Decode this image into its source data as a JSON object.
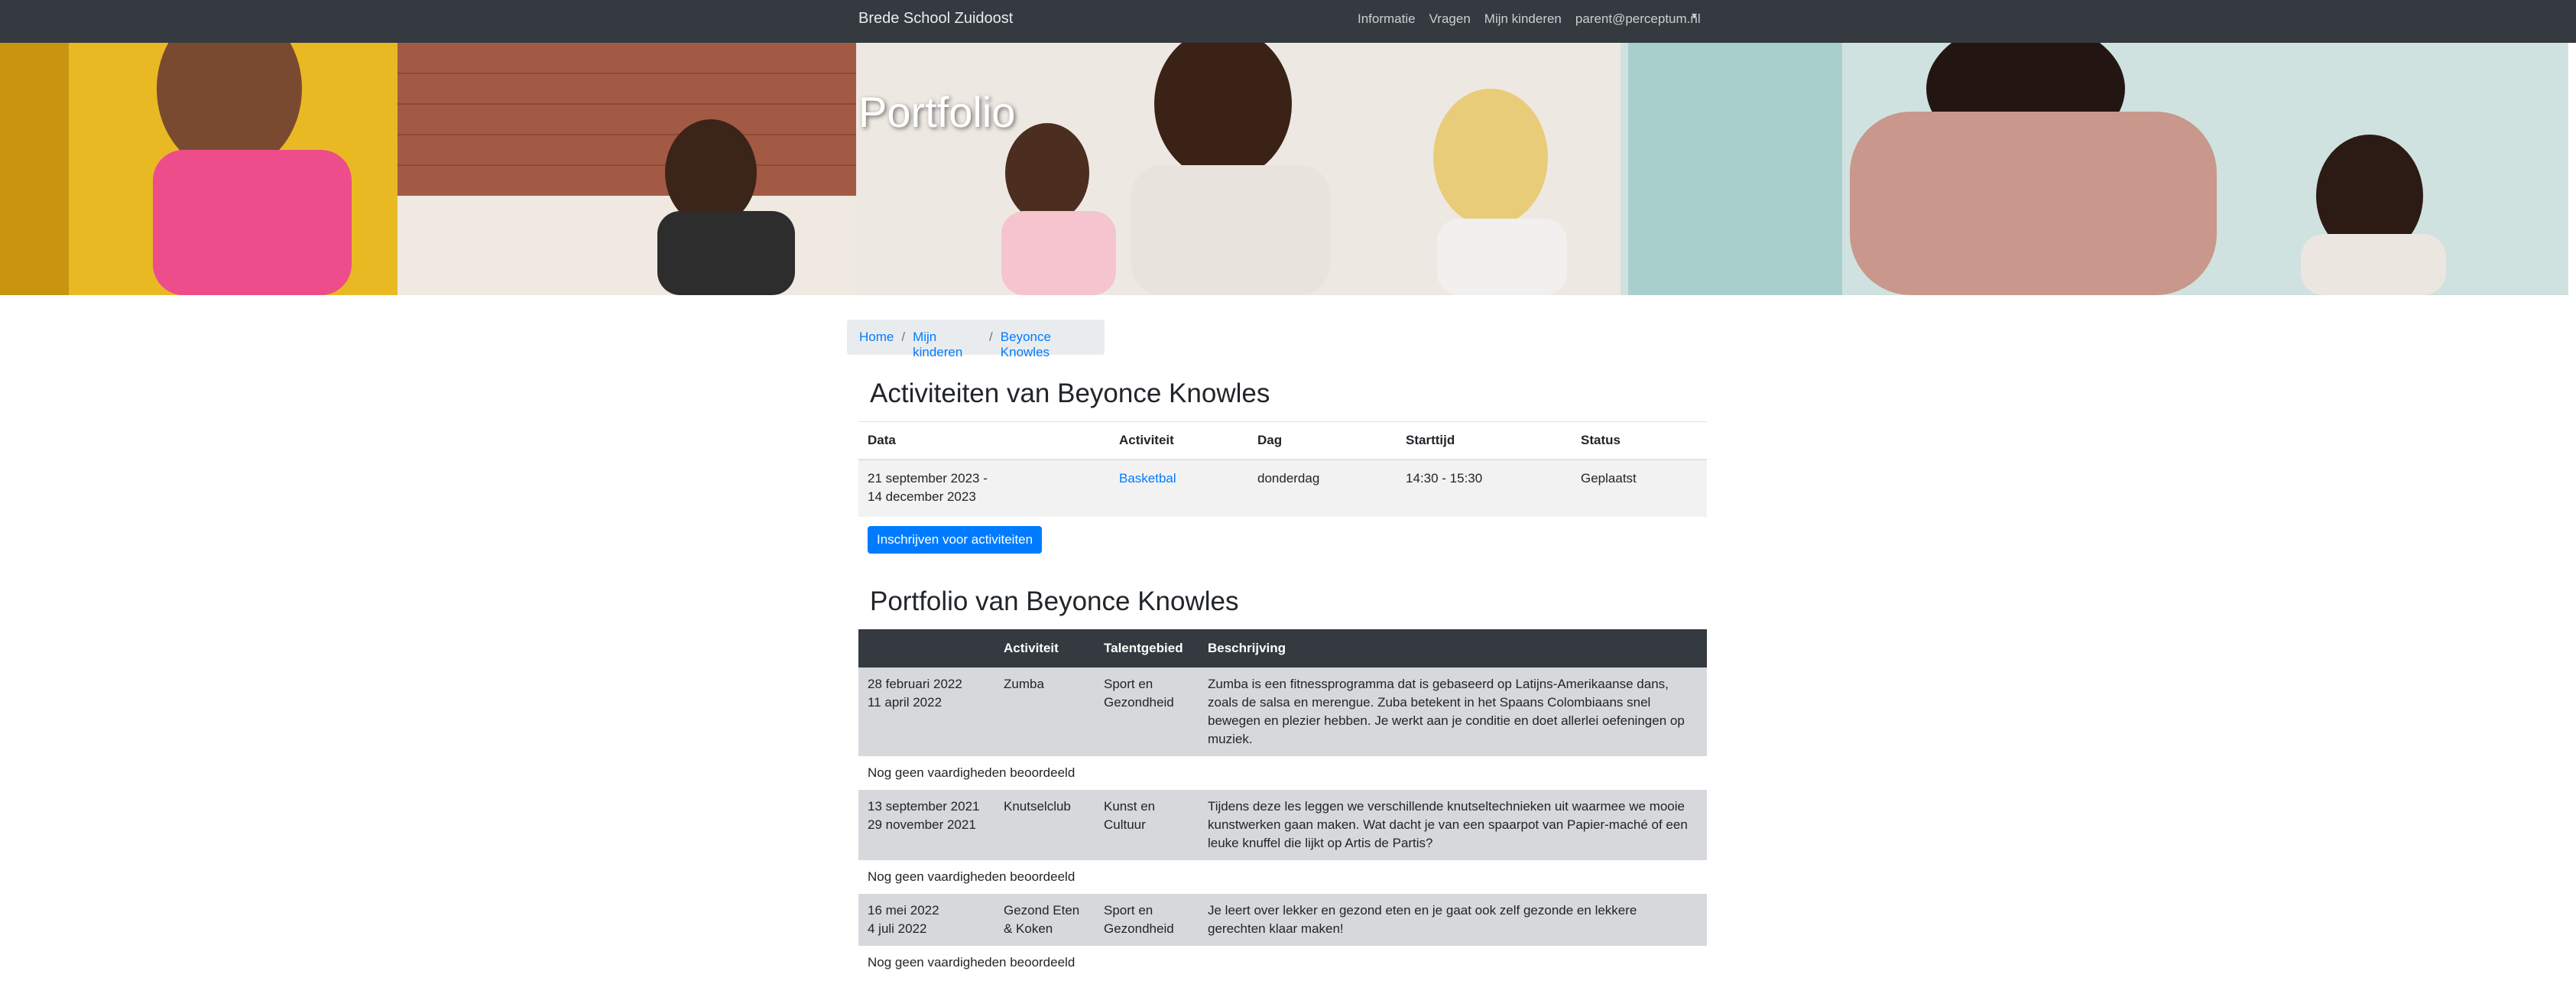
{
  "navbar": {
    "brand": "Brede School Zuidoost",
    "links": [
      "Informatie",
      "Vragen",
      "Mijn kinderen",
      "parent@perceptum.nl"
    ],
    "dropdown_icon": "caret-down-icon"
  },
  "hero": {
    "title": "Portfolio"
  },
  "breadcrumb": [
    "Home",
    "Mijn kinderen",
    "Beyonce Knowles"
  ],
  "activities": {
    "heading": "Activiteiten van Beyonce Knowles",
    "columns": [
      "Data",
      "Activiteit",
      "Dag",
      "Starttijd",
      "Status"
    ],
    "rows": [
      {
        "date_start": "21 september 2023 -",
        "date_end": "14 december 2023",
        "activity": "Basketbal",
        "day": "donderdag",
        "time": "14:30 - 15:30",
        "status": "Geplaatst"
      }
    ],
    "button": "Inschrijven voor activiteiten"
  },
  "portfolio": {
    "heading": "Portfolio van Beyonce Knowles",
    "columns": [
      "",
      "Activiteit",
      "Talentgebied",
      "Beschrijving"
    ],
    "rows": [
      {
        "date_start": "28 februari 2022",
        "date_end": "11 april 2022",
        "activity": "Zumba",
        "talent_1": "Sport en",
        "talent_2": "Gezondheid",
        "description": "Zumba is een fitnessprogramma dat is gebaseerd op Latijns-Amerikaanse dans, zoals de salsa en merengue. Zuba betekent in het Spaans Colombiaans snel bewegen en plezier hebben. Je werkt aan je conditie en doet allerlei oefeningen op muziek.",
        "note": "Nog geen vaardigheden beoordeeld"
      },
      {
        "date_start": "13 september 2021",
        "date_end": "29 november 2021",
        "activity": "Knutselclub",
        "talent_1": "Kunst en",
        "talent_2": "Cultuur",
        "description": "Tijdens deze les leggen we verschillende knutseltechnieken uit waarmee we mooie kunstwerken gaan maken. Wat dacht je van een spaarpot van Papier-maché of een leuke knuffel die lijkt op Artis de Partis?",
        "note": "Nog geen vaardigheden beoordeeld"
      },
      {
        "date_start": "16 mei 2022",
        "date_end": "4 juli 2022",
        "activity": "Gezond Eten & Koken",
        "talent_1": "Sport en",
        "talent_2": "Gezondheid",
        "description": "Je leert over lekker en gezond eten en je gaat ook zelf gezonde en lekkere gerechten klaar maken!",
        "note": "Nog geen vaardigheden beoordeeld"
      }
    ]
  }
}
